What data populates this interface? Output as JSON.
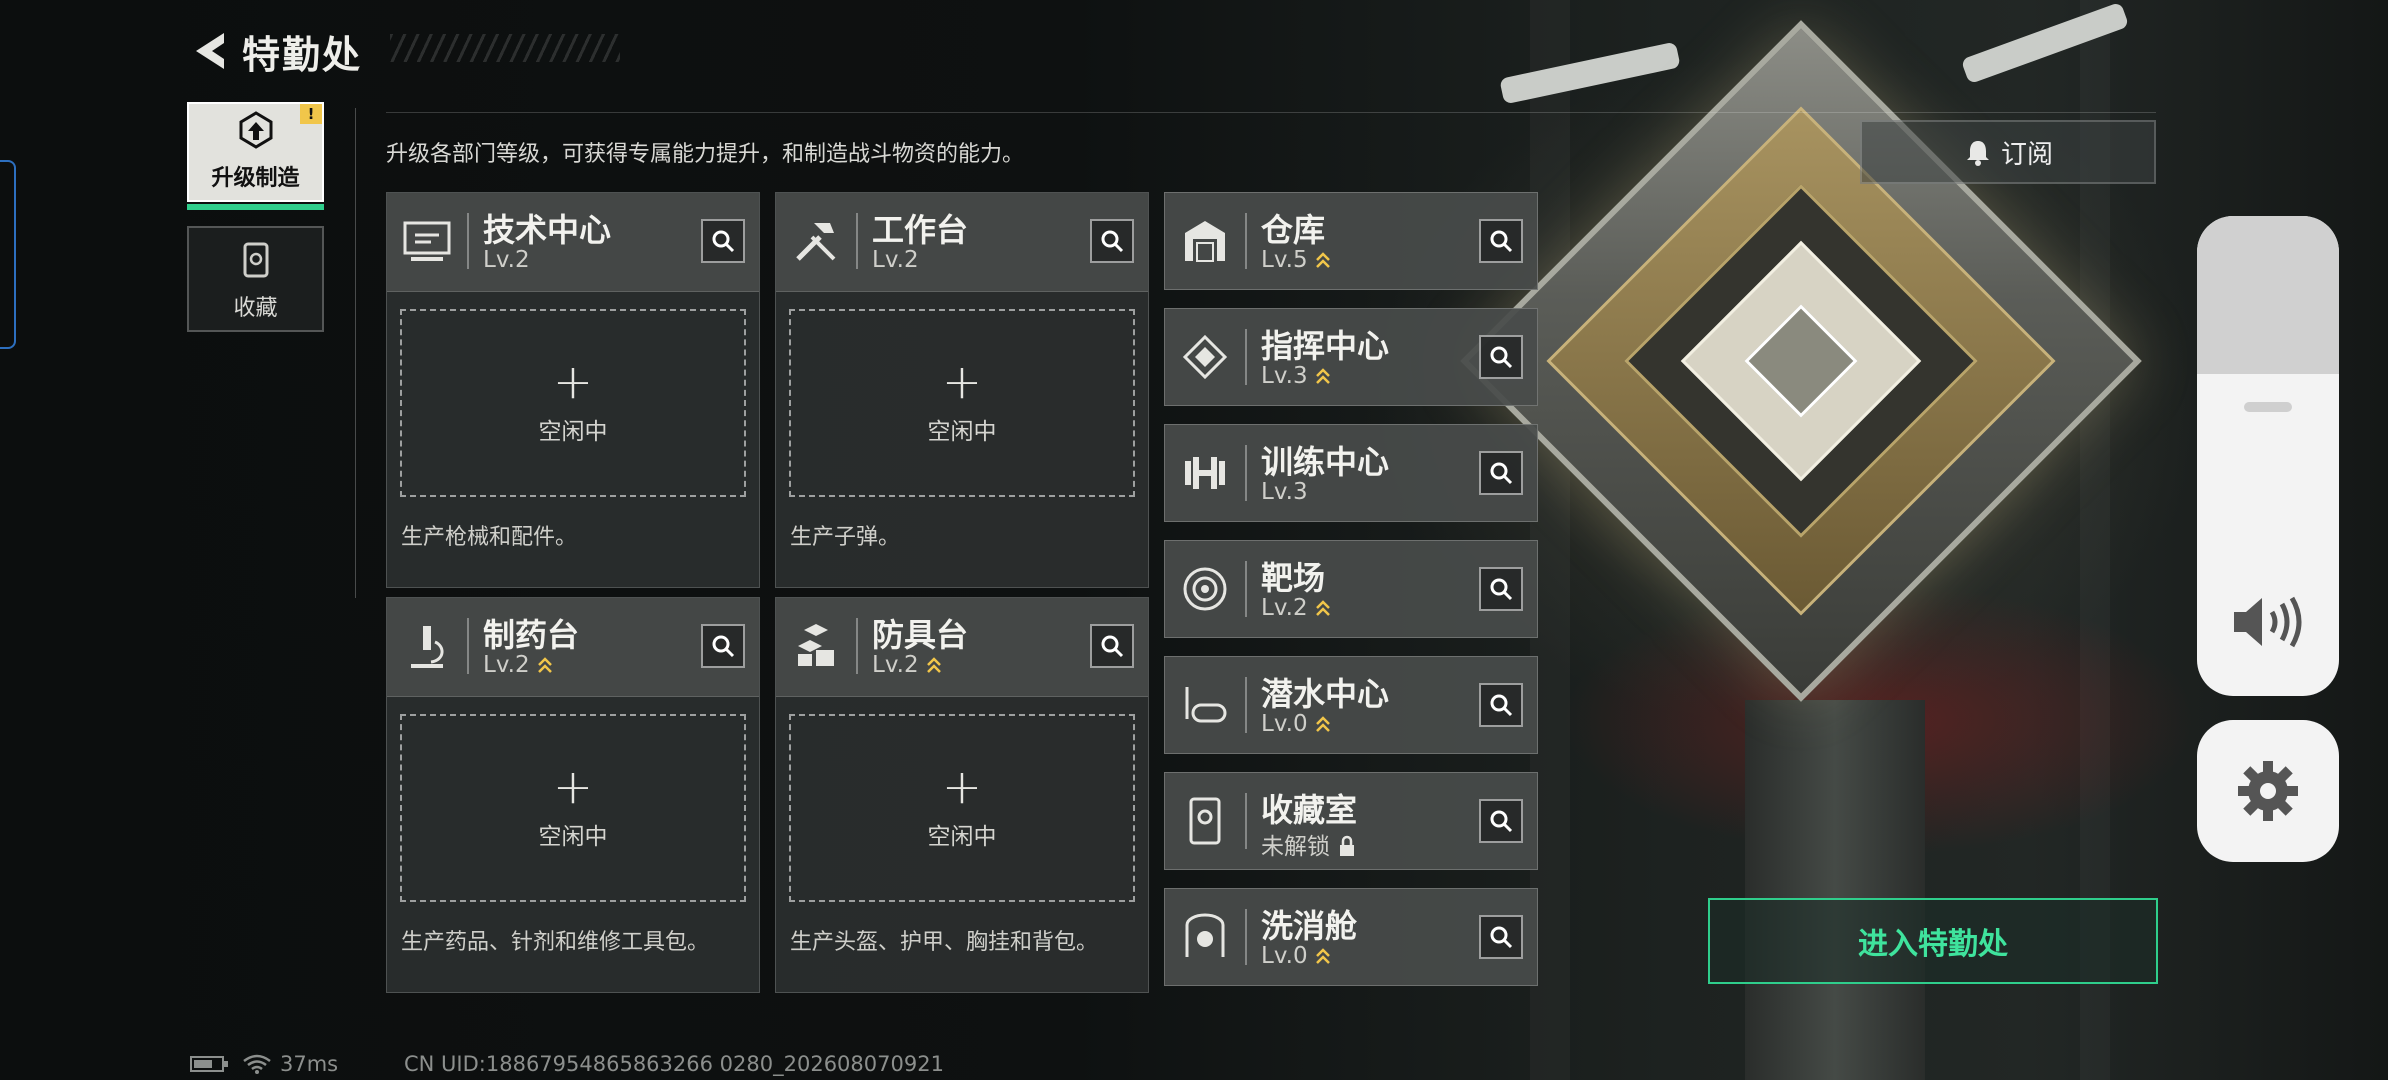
{
  "header": {
    "title": "特勤处"
  },
  "sidebar": {
    "tabs": [
      {
        "label": "升级制造",
        "active": true,
        "alert": "!"
      },
      {
        "label": "收藏",
        "active": false
      }
    ]
  },
  "description": "升级各部门等级，可获得专属能力提升，和制造战斗物资的能力。",
  "subscribe_label": "订阅",
  "production": [
    {
      "name": "技术中心",
      "level": "Lv.2",
      "upgrade": false,
      "slot": "空闲中",
      "desc": "生产枪械和配件。"
    },
    {
      "name": "工作台",
      "level": "Lv.2",
      "upgrade": false,
      "slot": "空闲中",
      "desc": "生产子弹。"
    },
    {
      "name": "制药台",
      "level": "Lv.2",
      "upgrade": true,
      "slot": "空闲中",
      "desc": "生产药品、针剂和维修工具包。"
    },
    {
      "name": "防具台",
      "level": "Lv.2",
      "upgrade": true,
      "slot": "空闲中",
      "desc": "生产头盔、护甲、胸挂和背包。"
    }
  ],
  "departments": [
    {
      "name": "仓库",
      "level": "Lv.5",
      "upgrade": true
    },
    {
      "name": "指挥中心",
      "level": "Lv.3",
      "upgrade": true
    },
    {
      "name": "训练中心",
      "level": "Lv.3",
      "upgrade": false
    },
    {
      "name": "靶场",
      "level": "Lv.2",
      "upgrade": true
    },
    {
      "name": "潜水中心",
      "level": "Lv.0",
      "upgrade": true
    },
    {
      "name": "收藏室",
      "level": "未解锁",
      "locked": true
    },
    {
      "name": "洗消舱",
      "level": "Lv.0",
      "upgrade": true
    }
  ],
  "enter_label": "进入特勤处",
  "status_bar": {
    "ping": "37ms",
    "uid": "CN UID:18867954865863266 0280_202608070921"
  },
  "colors": {
    "accent_green": "#2fce8c",
    "upgrade_gold": "#f1c64a"
  },
  "overlay": {
    "volume_icon": "speaker-icon",
    "settings_icon": "gear-icon"
  }
}
